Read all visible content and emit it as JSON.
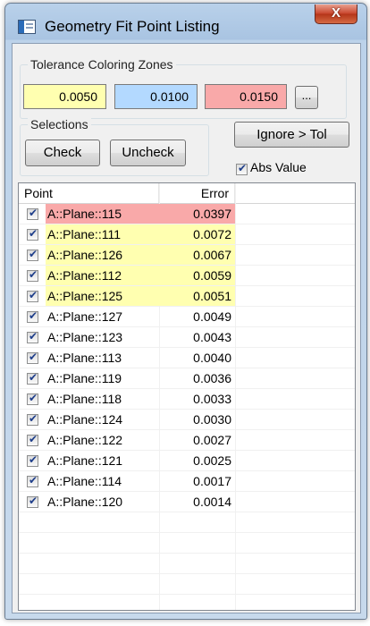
{
  "window": {
    "title": "Geometry Fit Point Listing",
    "close_label": "X"
  },
  "colors": {
    "zone_low": "#ffffb0",
    "zone_mid": "#b3d9ff",
    "zone_high": "#f9a9a9"
  },
  "tolerance": {
    "label": "Tolerance Coloring Zones",
    "zones": [
      "0.0050",
      "0.0100",
      "0.0150"
    ],
    "more_label": "..."
  },
  "selections": {
    "label": "Selections",
    "check_label": "Check",
    "uncheck_label": "Uncheck"
  },
  "ignore_label": "Ignore > Tol",
  "abs_value_label": "Abs Value",
  "list": {
    "columns": [
      "Point",
      "Error"
    ],
    "rows": [
      {
        "name": "A::Plane::115",
        "error": "0.0397",
        "zone": "high"
      },
      {
        "name": "A::Plane::111",
        "error": "0.0072",
        "zone": "low"
      },
      {
        "name": "A::Plane::126",
        "error": "0.0067",
        "zone": "low"
      },
      {
        "name": "A::Plane::112",
        "error": "0.0059",
        "zone": "low"
      },
      {
        "name": "A::Plane::125",
        "error": "0.0051",
        "zone": "low"
      },
      {
        "name": "A::Plane::127",
        "error": "0.0049",
        "zone": "none"
      },
      {
        "name": "A::Plane::123",
        "error": "0.0043",
        "zone": "none"
      },
      {
        "name": "A::Plane::113",
        "error": "0.0040",
        "zone": "none"
      },
      {
        "name": "A::Plane::119",
        "error": "0.0036",
        "zone": "none"
      },
      {
        "name": "A::Plane::118",
        "error": "0.0033",
        "zone": "none"
      },
      {
        "name": "A::Plane::124",
        "error": "0.0030",
        "zone": "none"
      },
      {
        "name": "A::Plane::122",
        "error": "0.0027",
        "zone": "none"
      },
      {
        "name": "A::Plane::121",
        "error": "0.0025",
        "zone": "none"
      },
      {
        "name": "A::Plane::114",
        "error": "0.0017",
        "zone": "none"
      },
      {
        "name": "A::Plane::120",
        "error": "0.0014",
        "zone": "none"
      }
    ]
  }
}
